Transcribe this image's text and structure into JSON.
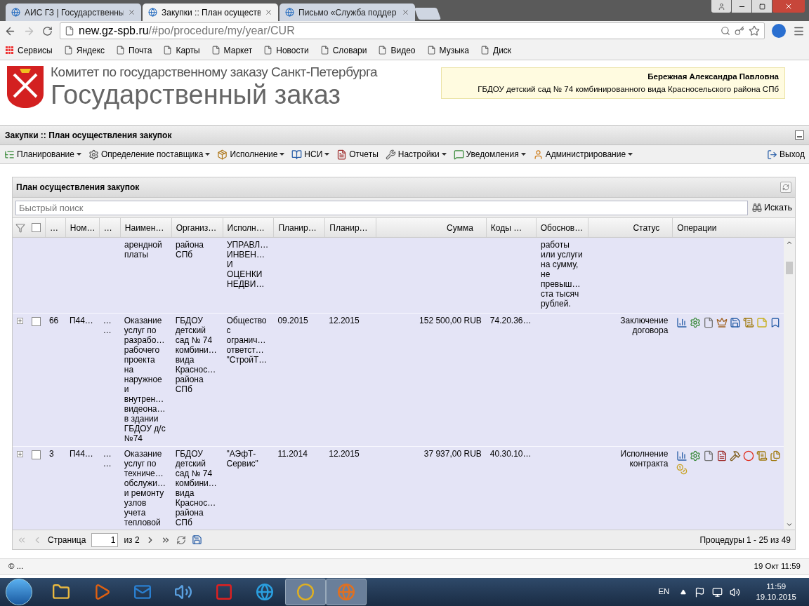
{
  "browser": {
    "tabs": [
      {
        "label": "АИС ГЗ | Государственны",
        "selected": false
      },
      {
        "label": "Закупки :: План осуществ",
        "selected": true
      },
      {
        "label": "Письмо «Служба поддер",
        "selected": false
      }
    ],
    "address": {
      "domain": "new.gz-spb.ru",
      "path": "/#po/procedure/my/year/CUR"
    },
    "bookmarks": [
      {
        "label": "Сервисы",
        "kind": "apps"
      },
      {
        "label": "Яндекс",
        "kind": "page"
      },
      {
        "label": "Почта",
        "kind": "page"
      },
      {
        "label": "Карты",
        "kind": "page"
      },
      {
        "label": "Маркет",
        "kind": "page"
      },
      {
        "label": "Новости",
        "kind": "page"
      },
      {
        "label": "Словари",
        "kind": "page"
      },
      {
        "label": "Видео",
        "kind": "page"
      },
      {
        "label": "Музыка",
        "kind": "page"
      },
      {
        "label": "Диск",
        "kind": "page"
      }
    ]
  },
  "header": {
    "subtitle": "Комитет по государственному заказу Санкт-Петербурга",
    "title": "Государственный заказ",
    "user": {
      "name": "Бережная Александра Павловна",
      "org": "ГБДОУ детский сад № 74 комбинированного вида Красносельского района СПб"
    }
  },
  "panel_title": "Закупки :: План осуществления закупок",
  "menu": [
    {
      "label": "Планирование",
      "dropdown": true
    },
    {
      "label": "Определение поставщика",
      "dropdown": true
    },
    {
      "label": "Исполнение",
      "dropdown": true
    },
    {
      "label": "НСИ",
      "dropdown": true
    },
    {
      "label": "Отчеты",
      "dropdown": false
    },
    {
      "label": "Настройки",
      "dropdown": true
    },
    {
      "label": "Уведомления",
      "dropdown": true
    },
    {
      "label": "Администрирование",
      "dropdown": true
    }
  ],
  "logout": "Выход",
  "grid": {
    "title": "План осуществления закупок",
    "search": {
      "placeholder": "Быстрый поиск",
      "button": "Искать"
    },
    "select_all": {
      "checked": false
    },
    "columns": [
      "…",
      "Ном…",
      "…",
      "Наимен…",
      "Организ…",
      "Исполн…",
      "Планир…",
      "Планир…",
      "Сумма",
      "Коды …",
      "Обоснов…",
      "Статус",
      "Операции"
    ],
    "rows": [
      {
        "kind": "clipped",
        "cells": [
          [],
          [],
          [],
          [
            "арендной",
            "платы"
          ],
          [
            "района",
            "СПб"
          ],
          [
            "УПРАВЛ…",
            "ИНВЕН…",
            "И",
            "ОЦЕНКИ",
            "НЕДВИ…"
          ],
          [],
          [],
          [],
          [],
          [
            "работы",
            "или услуги",
            "на сумму,",
            "не",
            "превыш…",
            "ста тысяч",
            "рублей."
          ],
          []
        ]
      },
      {
        "kind": "full",
        "checked": false,
        "cells": [
          [
            "66"
          ],
          [
            "П44…"
          ],
          [
            "…",
            "…"
          ],
          [
            "Оказание",
            "услуг по",
            "разрабо…",
            "рабочего",
            "проекта",
            "на",
            "наружное",
            "и",
            "внутрен…",
            "видеона…",
            "в здании",
            "ГБДОУ д/с",
            "№74"
          ],
          [
            "ГБДОУ",
            "детский",
            "сад № 74",
            "комбини…",
            "вида",
            "Краснос…",
            "района",
            "СПб"
          ],
          [
            "Общество",
            "с",
            "огранич…",
            "ответст…",
            "\"СтройТ…"
          ],
          [
            "09.2015"
          ],
          [
            "12.2015"
          ],
          [
            "152 500,00 RUB"
          ],
          [
            "74.20.36…"
          ],
          [],
          [
            "Заключение",
            "договора"
          ]
        ]
      },
      {
        "kind": "full",
        "checked": false,
        "cells": [
          [
            "3"
          ],
          [
            "П44…"
          ],
          [
            "…",
            "…"
          ],
          [
            "Оказание",
            "услуг по",
            "техниче…",
            "обслужи…",
            "и ремонту",
            "узлов",
            "учета",
            "тепловой"
          ],
          [
            "ГБДОУ",
            "детский",
            "сад № 74",
            "комбини…",
            "вида",
            "Краснос…",
            "района",
            "СПб"
          ],
          [
            "\"АЭфТ-",
            "Сервис\""
          ],
          [
            "11.2014"
          ],
          [
            "12.2015"
          ],
          [
            "37 937,00 RUB"
          ],
          [
            "40.30.10…"
          ],
          [],
          [
            "Исполнение",
            "контракта"
          ]
        ]
      }
    ],
    "pager": {
      "page_label": "Страница",
      "page": "1",
      "of": "из 2",
      "summary": "Процедуры 1 - 25 из 49"
    }
  },
  "footer": {
    "copyright": "© ...",
    "datetime": "19 Окт 11:59"
  },
  "taskbar": {
    "apps": [
      {
        "kind": "explorer",
        "running": false
      },
      {
        "kind": "media",
        "running": false
      },
      {
        "kind": "mail",
        "running": false
      },
      {
        "kind": "sound",
        "running": false
      },
      {
        "kind": "yandex",
        "running": false
      },
      {
        "kind": "ie",
        "running": false
      },
      {
        "kind": "chrome",
        "running": true
      },
      {
        "kind": "firefox",
        "running": true
      }
    ],
    "language": "EN",
    "time": "11:59",
    "date": "19.10.2015"
  }
}
